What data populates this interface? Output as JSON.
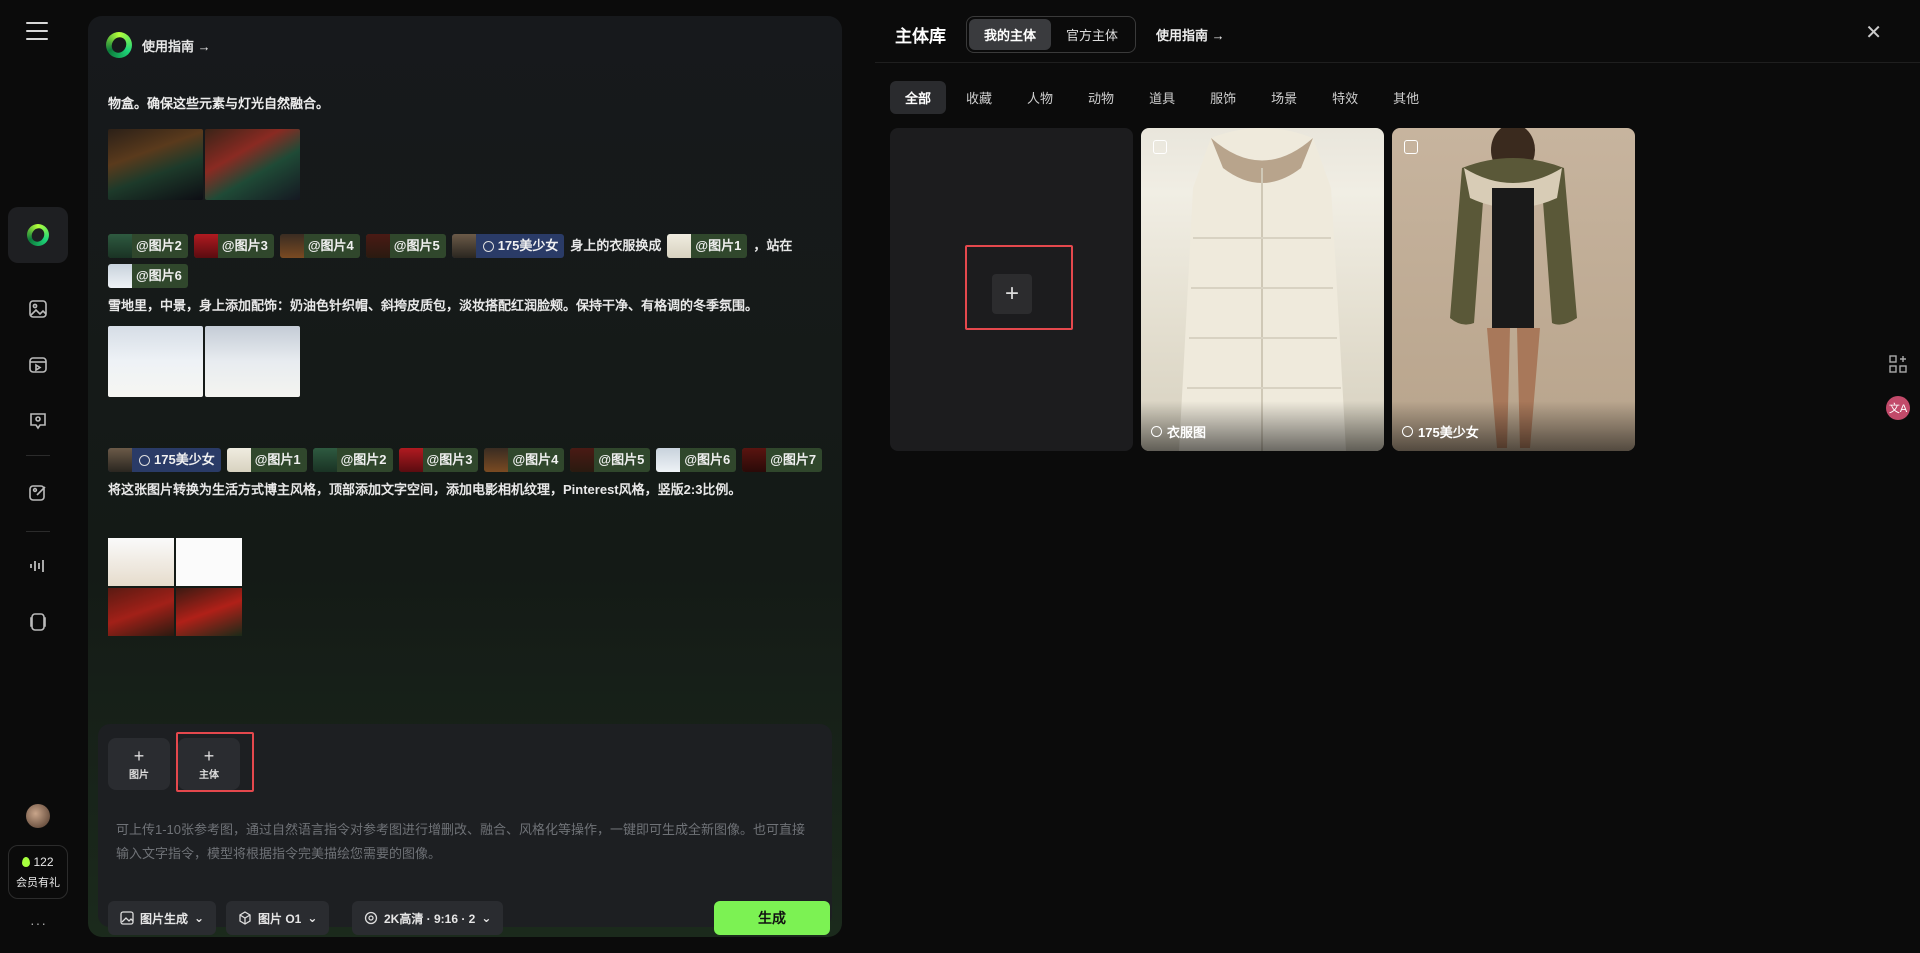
{
  "chat": {
    "guide_label": "使用指南 →",
    "messages": [
      {
        "text": "物盒。确保这些元素与灯光自然融合。"
      },
      {
        "line1_chips": [
          "@图片2",
          "@图片3",
          "@图片4",
          "@图片5"
        ],
        "subject_chip": "175美少女",
        "text_a": "身上的衣服换成",
        "chip_b": "@图片1",
        "text_b": "，站在",
        "chip_c": "@图片6",
        "text_c": "雪地里，中景，身上添加配饰：奶油色针织帽、斜挎皮质包，淡妆搭配红润脸颊。保持干净、有格调的冬季氛围。"
      },
      {
        "subject_chip": "175美少女",
        "chips": [
          "@图片1",
          "@图片2",
          "@图片3",
          "@图片4",
          "@图片5",
          "@图片6"
        ],
        "chip_last": "@图片7",
        "text": "将这张图片转换为生活方式博主风格，顶部添加文字空间，添加电影相机纹理，Pinterest风格，竖版2:3比例。"
      }
    ]
  },
  "composer": {
    "add_image_label": "图片",
    "add_subject_label": "主体",
    "placeholder": "可上传1-10张参考图，通过自然语言指令对参考图进行增删改、融合、风格化等操作，一键即可生成全新图像。也可直接输入文字指令，模型将根据指令完美描绘您需要的图像。",
    "mode": "图片生成",
    "model": "图片 O1",
    "settings": "2K高清 · 9:16 · 2",
    "generate": "生成"
  },
  "rail": {
    "credits": "122",
    "member": "会员有礼",
    "more": "···"
  },
  "library": {
    "title": "主体库",
    "tabs": [
      "我的主体",
      "官方主体"
    ],
    "active_tab": "我的主体",
    "guide": "使用指南 →",
    "categories": [
      "全部",
      "收藏",
      "人物",
      "动物",
      "道具",
      "服饰",
      "场景",
      "特效",
      "其他"
    ],
    "active_category": "全部",
    "items": [
      {
        "label": "衣服图"
      },
      {
        "label": "175美少女"
      }
    ]
  },
  "colors": {
    "accent": "#7cf253",
    "highlight_box": "#e5484d",
    "chip_green": "#30472c",
    "chip_blue": "#2a3b67"
  }
}
